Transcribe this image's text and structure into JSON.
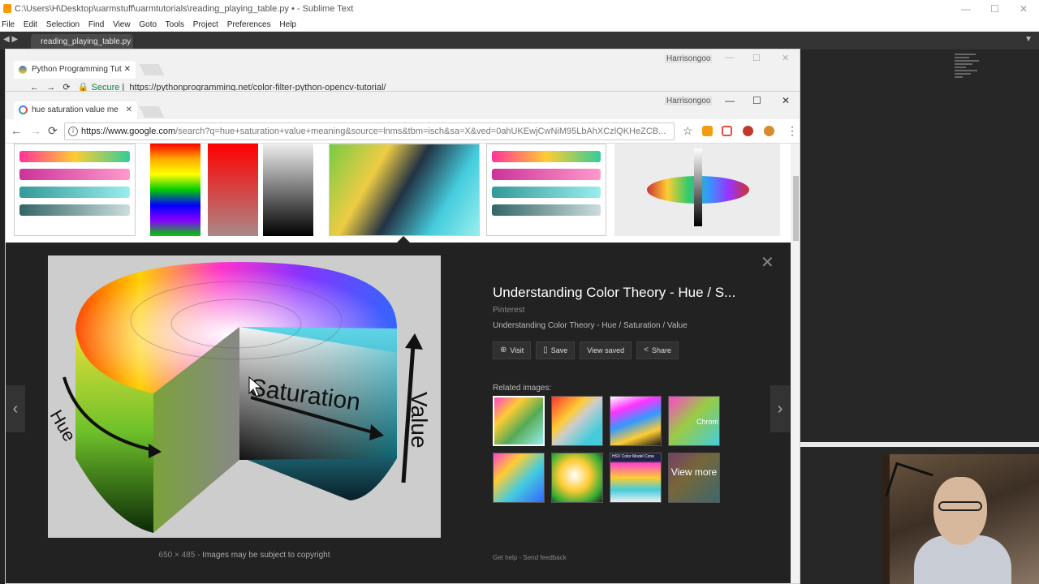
{
  "sublime": {
    "title": "C:\\Users\\H\\Desktop\\uarmstuff\\uarmtutorials\\reading_playing_table.py • - Sublime Text",
    "menu": [
      "File",
      "Edit",
      "Selection",
      "Find",
      "View",
      "Goto",
      "Tools",
      "Project",
      "Preferences",
      "Help"
    ],
    "tab": "reading_playing_table.py"
  },
  "chrome_back": {
    "tab_title": "Python Programming Tut",
    "user": "Harrisongoo",
    "secure_label": "Secure",
    "url": "https://pythonprogramming.net/color-filter-python-opencv-tutorial/"
  },
  "chrome_front": {
    "tab_title": "hue saturation value me",
    "user": "Harrisongoo",
    "url_host": "https://www.google.com",
    "url_rest": "/search?q=hue+saturation+value+meaning&source=lnms&tbm=isch&sa=X&ved=0ahUKEwjCwNiM95LbAhXCzlQKHeZCB..."
  },
  "panel": {
    "title": "Understanding Color Theory - Hue / S...",
    "source": "Pinterest",
    "description": "Understanding Color Theory - Hue / Saturation / Value",
    "buttons": {
      "visit": "Visit",
      "save": "Save",
      "view_saved": "View saved",
      "share": "Share"
    },
    "image_labels": {
      "saturation": "Saturation",
      "value": "Value",
      "hue": "Hue"
    },
    "dimensions": "650 × 485",
    "copyright": "Images may be subject to copyright",
    "related_label": "Related images:",
    "view_more": "View more",
    "related_thumb_labels": {
      "chroma": "Chrom",
      "hsv_model": "HSV Color Model Cone"
    },
    "get_help": "Get help",
    "send_feedback": "Send feedback"
  },
  "colors": {
    "panel_bg": "#222222",
    "sublime_bg": "#2b2b2b",
    "omnibox_text": "#222222"
  }
}
